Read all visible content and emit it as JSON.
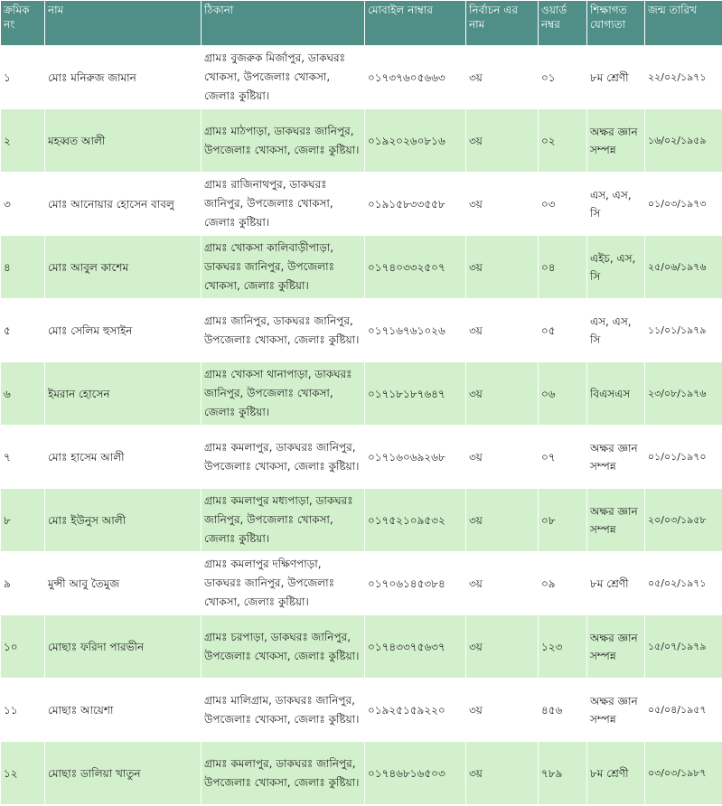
{
  "table": {
    "headers": {
      "serial": "ক্রমিক নং",
      "name": "নাম",
      "address": "ঠিকানা",
      "mobile": "মোবাইল নাম্বার",
      "election": "নির্বাচন এর নাম",
      "ward": "ওয়ার্ড নম্বর",
      "education": "শিক্ষাগত যোগ্যতা",
      "dob": "জন্ম তারিখ"
    },
    "rows": [
      {
        "serial": "১",
        "name": "মোঃ মনিরুজ জামান",
        "address": "গ্রামঃ বুজরুক মির্জাপুর, ডাকঘরঃ খোকসা, উপজেলাঃ খোকসা, জেলাঃ কুষ্টিয়া।",
        "mobile": "০১৭৩৭৬০৫৬৬৩",
        "election": "৩য়",
        "ward": "০১",
        "education": "৮ম শ্রেণী",
        "dob": "২২/০২/১৯৭১"
      },
      {
        "serial": "২",
        "name": "মহব্বত আলী",
        "address": "গ্রামঃ মাঠপাড়া, ডাকঘরঃ জানিপুর, উপজেলাঃ খোকসা, জেলাঃ কুষ্টিয়া।",
        "mobile": "০১৯২০২৬০৮১৬",
        "election": "৩য়",
        "ward": "০২",
        "education": "অক্ষর জ্ঞান সম্পন্ন",
        "dob": "১৬/০২/১৯৫৯"
      },
      {
        "serial": "৩",
        "name": "মোঃ আনোয়ার হোসেন বাবলু",
        "address": "গ্রামঃ রাজিনাথপুর, ডাকঘরঃ জানিপুর, উপজেলাঃ খোকসা, জেলাঃ কুষ্টিয়া।",
        "mobile": "০১৯১৫৮৩৩৫৫৮",
        "election": "৩য়",
        "ward": "০৩",
        "education": "এস, এস, সি",
        "dob": "০১/০৩/১৯৭৩"
      },
      {
        "serial": "৪",
        "name": "মোঃ আবুল কাশেম",
        "address": "গ্রামঃ খোকসা কালিবাড়ীপাড়া, ডাকঘরঃ জানিপুর, উপজেলাঃ খোকসা, জেলাঃ কুষ্টিয়া।",
        "mobile": "০১৭৪০৩৩২৫০৭",
        "election": "৩য়",
        "ward": "০৪",
        "education": "এইচ, এস, সি",
        "dob": "২৫/০৬/১৯৭৬"
      },
      {
        "serial": "৫",
        "name": "মোঃ সেলিম হুসাইন",
        "address": "গ্রামঃ জানিপুর, ডাকঘরঃ জানিপুর, উপজেলাঃ খোকসা, জেলাঃ কুষ্টিয়া।",
        "mobile": "০১৭১৬৭৬১০২৬",
        "election": "৩য়",
        "ward": "০৫",
        "education": "এস, এস, সি",
        "dob": "১১/০১/১৯৭৯"
      },
      {
        "serial": "৬",
        "name": "ইমরান হোসেন",
        "address": "গ্রামঃ খোকসা থানাপাড়া, ডাকঘরঃ জানিপুর, উপজেলাঃ খোকসা, জেলাঃ কুষ্টিয়া।",
        "mobile": "০১৭১৮১৮৭৬৪৭",
        "election": "৩য়",
        "ward": "০৬",
        "education": "বিএসএস",
        "dob": "২৩/০৮/১৯৭৬"
      },
      {
        "serial": "৭",
        "name": "মোঃ হাসেম আলী",
        "address": "গ্রামঃ কমলাপুর, ডাকঘরঃ জানিপুর, উপজেলাঃ খোকসা, জেলাঃ কুষ্টিয়া।",
        "mobile": "০১৭১৬০৬৯২৬৮",
        "election": "৩য়",
        "ward": "০৭",
        "education": "অক্ষর জ্ঞান সম্পন্ন",
        "dob": "০১/০১/১৯৭০"
      },
      {
        "serial": "৮",
        "name": "মোঃ ইউনুস আলী",
        "address": "গ্রামঃ কমলাপুর মধ্যপাড়া, ডাকঘরঃ জানিপুর, উপজেলাঃ খোকসা, জেলাঃ কুষ্টিয়া।",
        "mobile": "০১৭৫২১০৯৫৩২",
        "election": "৩য়",
        "ward": "০৮",
        "education": "অক্ষর জ্ঞান সম্পন্ন",
        "dob": "২০/০৩/১৯৫৮"
      },
      {
        "serial": "৯",
        "name": "মুন্সী আবু তৈমুজ",
        "address": "গ্রামঃ কমলাপুর দক্ষিণপাড়া, ডাকঘরঃ জানিপুর, উপজেলাঃ খোকসা, জেলাঃ কুষ্টিয়া।",
        "mobile": "০১৭০৬১৪৫৩৮৪",
        "election": "৩য়",
        "ward": "০৯",
        "education": "৮ম শ্রেণী",
        "dob": "০৫/০২/১৯৭১"
      },
      {
        "serial": "১০",
        "name": "মোছাঃ ফরিদা পারভীন",
        "address": "গ্রামঃ চরপাড়া, ডাকঘরঃ জানিপুর, উপজেলাঃ খোকসা, জেলাঃ কুষ্টিয়া।",
        "mobile": "০১৭৪৩৩৭৫৬৩৭",
        "election": "৩য়",
        "ward": "১২৩",
        "education": "অক্ষর জ্ঞান সম্পন্ন",
        "dob": "১৫/০৭/১৯৭৯"
      },
      {
        "serial": "১১",
        "name": "মোছাঃ আয়েশা",
        "address": "গ্রামঃ মালিগ্রাম, ডাকঘরঃ জানিপুর, উপজেলাঃ খোকসা, জেলাঃ কুষ্টিয়া।",
        "mobile": "০১৯২৫১৫৯২২০",
        "election": "৩য়",
        "ward": "৪৫৬",
        "education": "অক্ষর জ্ঞান সম্পন্ন",
        "dob": "০৫/০৪/১৯৫৭"
      },
      {
        "serial": "১২",
        "name": "মোছাঃ ডালিয়া খাতুন",
        "address": "গ্রামঃ কমলাপুর, ডাকঘরঃ জানিপুর, উপজেলাঃ খোকসা, জেলাঃ কুষ্টিয়া।",
        "mobile": "০১৭৪৬৮১৬৫০৩",
        "election": "৩য়",
        "ward": "৭৮৯",
        "education": "৮ম শ্রেণী",
        "dob": "০৩/০৩/১৯৮৭"
      }
    ]
  },
  "colors": {
    "header_bg": "#4f8f87",
    "header_text": "#ffffff",
    "row_alt_bg": "#d2f0cb",
    "row_bg": "#ffffff"
  }
}
